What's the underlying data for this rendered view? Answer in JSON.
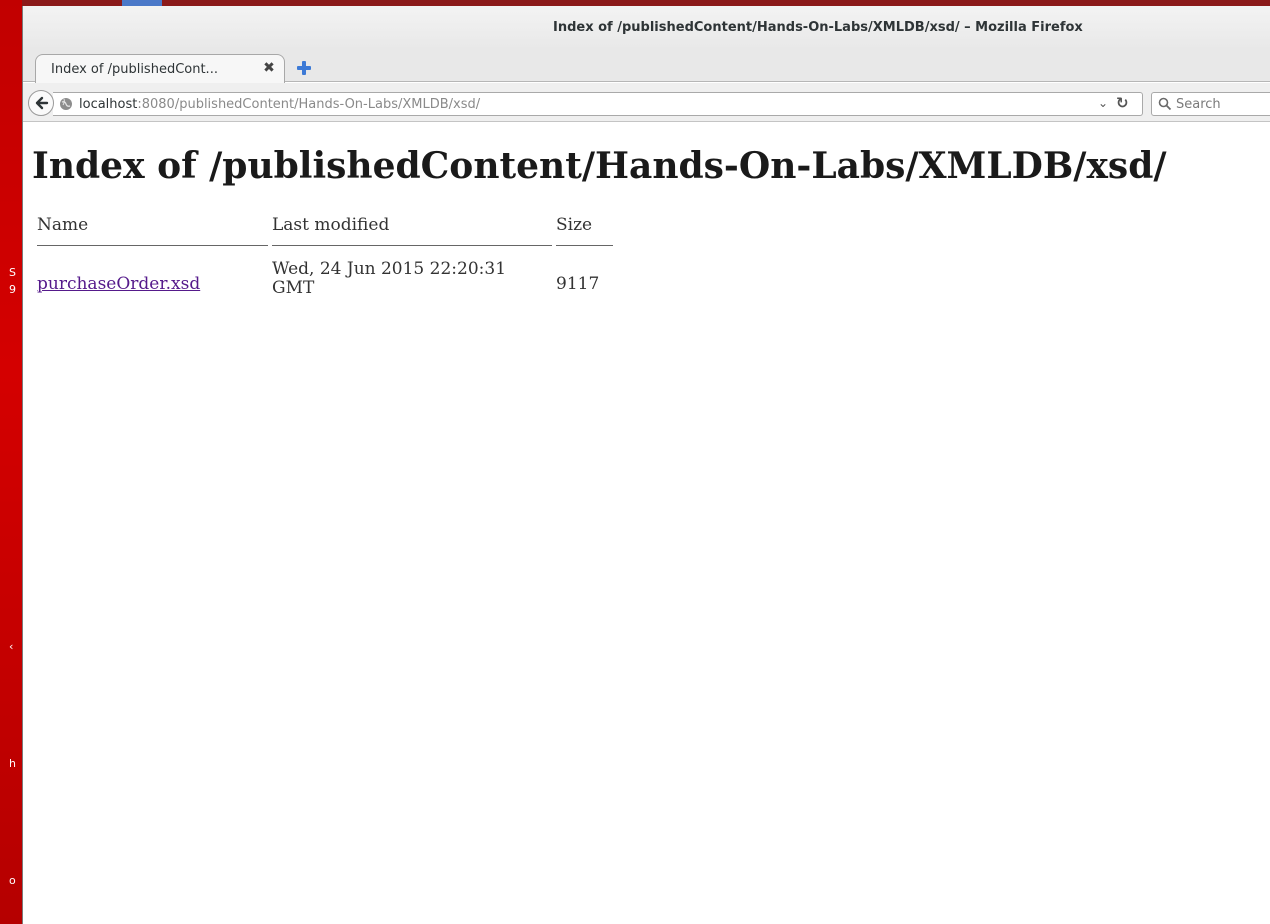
{
  "window": {
    "title": "Index of /publishedContent/Hands-On-Labs/XMLDB/xsd/ – Mozilla Firefox"
  },
  "tabs": [
    {
      "label": "Index of /publishedCont...",
      "close_icon": "close-icon"
    }
  ],
  "newtab": {
    "icon": "plus-icon"
  },
  "navbar": {
    "back_icon": "back-arrow-icon",
    "url_host": "localhost",
    "url_rest": ":8080/publishedContent/Hands-On-Labs/XMLDB/xsd/",
    "dropdown_glyph": "⌄",
    "reload_glyph": "↻",
    "search_placeholder": "Search"
  },
  "page": {
    "title": "Index of /publishedContent/Hands-On-Labs/XMLDB/xsd/",
    "columns": [
      "Name",
      "Last modified",
      "Size"
    ],
    "rows": [
      {
        "name": "purchaseOrder.xsd",
        "modified_line1": "Wed, 24 Jun 2015 22:20:31",
        "modified_line2": "GMT",
        "size": "9117"
      }
    ]
  },
  "desktop": {
    "fragments": [
      "S",
      "9",
      "‹",
      "h",
      "o"
    ]
  },
  "colors": {
    "desktop_bg": "#c10000",
    "link_visited": "#551a8b",
    "accent_blue": "#4a78c8"
  }
}
